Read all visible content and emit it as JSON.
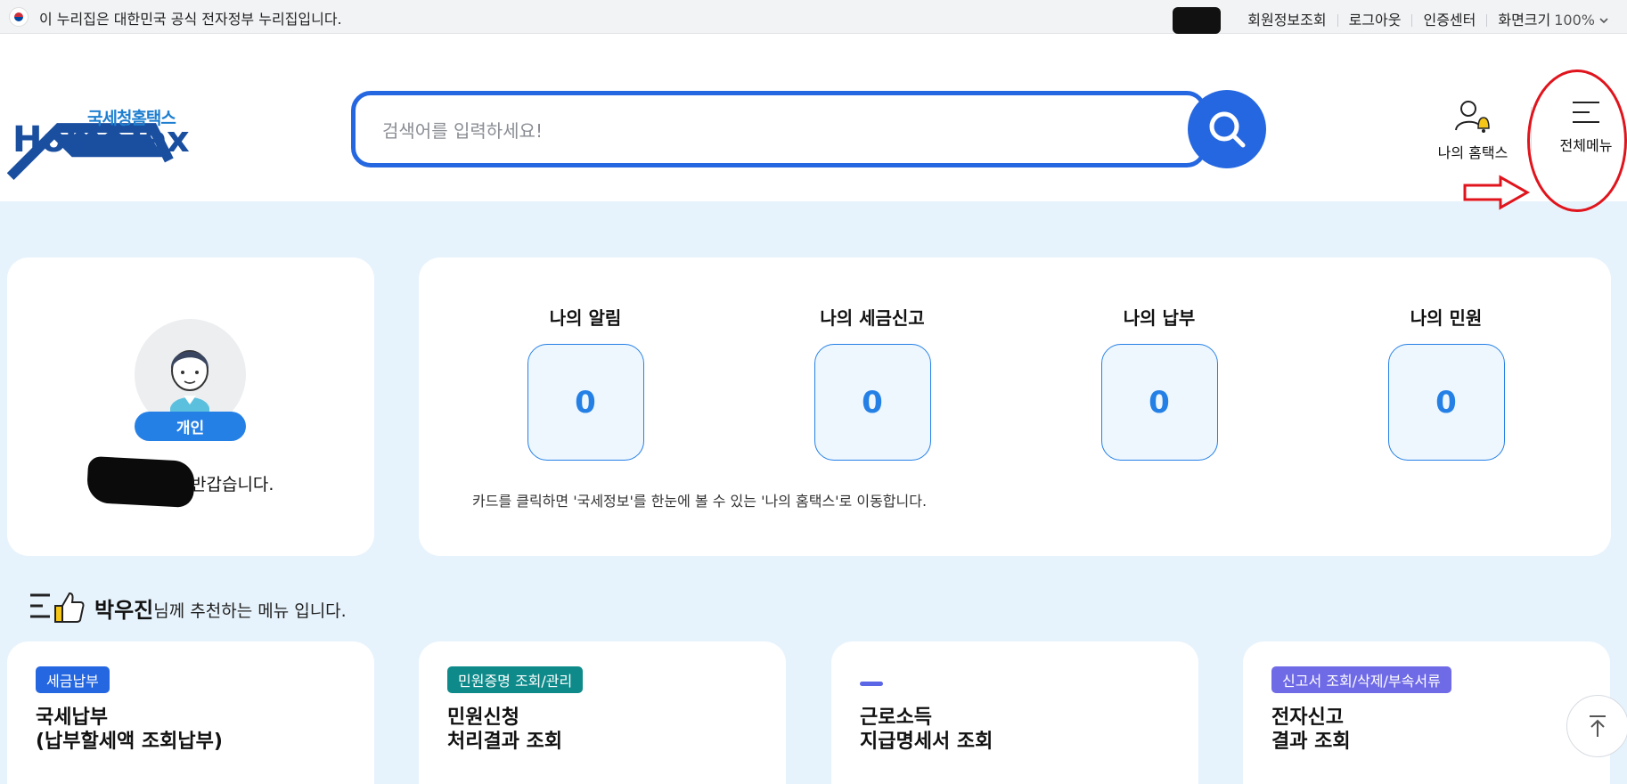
{
  "gov_banner": {
    "text": "이 누리집은 대한민국 공식 전자정부 누리집입니다.",
    "links": [
      "회원정보조회",
      "로그아웃",
      "인증센터"
    ],
    "zoom_label": "화면크기",
    "zoom_value": "100%"
  },
  "header": {
    "logo_sub": "국세청홈택스",
    "logo_main": "HomeTax",
    "search_placeholder": "검색어를 입력하세요!",
    "my_hometax_label": "나의 홈택스",
    "all_menu_label": "전체메뉴"
  },
  "profile": {
    "type_badge": "개인",
    "greeting": "반갑습니다."
  },
  "summary": {
    "stats": [
      {
        "title": "나의 알림",
        "value": "0"
      },
      {
        "title": "나의 세금신고",
        "value": "0"
      },
      {
        "title": "나의 납부",
        "value": "0"
      },
      {
        "title": "나의 민원",
        "value": "0"
      }
    ],
    "hint": "카드를 클릭하면 '국세정보'를 한눈에 볼 수 있는 '나의 홈택스'로 이동합니다."
  },
  "recommend": {
    "user_name": "박우진",
    "suffix": "님께 추천하는 메뉴 입니다.",
    "cards": [
      {
        "tag": "세금납부",
        "tag_color": "#2567e0",
        "title_line1": "국세납부",
        "title_line2": "(납부할세액 조회납부)"
      },
      {
        "tag": "민원증명 조회/관리",
        "tag_color": "#0e8a8a",
        "title_line1": "민원신청",
        "title_line2": "처리결과 조회"
      },
      {
        "tag": "",
        "tag_color": "#5a66e6",
        "title_line1": "근로소득",
        "title_line2": "지급명세서 조회"
      },
      {
        "tag": "신고서 조회/삭제/부속서류",
        "tag_color": "#6f6ae6",
        "title_line1": "전자신고",
        "title_line2": "결과 조회"
      }
    ]
  },
  "annotation": {
    "color": "#e0141d"
  }
}
